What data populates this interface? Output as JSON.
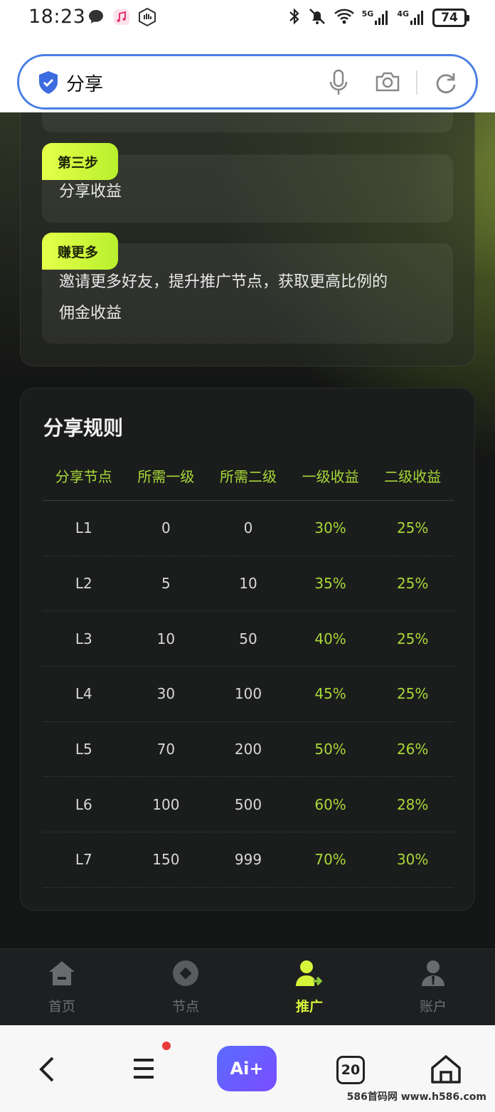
{
  "status_bar": {
    "time": "18:23",
    "network_5g": "5G",
    "network_4g": "4G",
    "battery": "74",
    "icons": [
      "message-icon",
      "music-icon",
      "hand-icon",
      "bluetooth-icon",
      "mute-icon",
      "wifi-icon",
      "signal-icon"
    ]
  },
  "search": {
    "query": "分享",
    "icons": [
      "shield-icon",
      "mic-icon",
      "camera-icon",
      "reload-icon"
    ]
  },
  "steps": [
    {
      "tag": "第三步",
      "text": "分享收益"
    },
    {
      "tag": "赚更多",
      "text_line1": "邀请更多好友，提升推广节点，获取更高比例的",
      "text_line2": "佣金收益"
    }
  ],
  "rules": {
    "title": "分享规则",
    "headers": [
      "分享节点",
      "所需一级",
      "所需二级",
      "一级收益",
      "二级收益"
    ],
    "rows": [
      [
        "L1",
        "0",
        "0",
        "30%",
        "25%"
      ],
      [
        "L2",
        "5",
        "10",
        "35%",
        "25%"
      ],
      [
        "L3",
        "10",
        "50",
        "40%",
        "25%"
      ],
      [
        "L4",
        "30",
        "100",
        "45%",
        "25%"
      ],
      [
        "L5",
        "70",
        "200",
        "50%",
        "26%"
      ],
      [
        "L6",
        "100",
        "500",
        "60%",
        "28%"
      ],
      [
        "L7",
        "150",
        "999",
        "70%",
        "30%"
      ]
    ]
  },
  "tabbar": {
    "items": [
      {
        "label": "首页",
        "icon": "home-icon",
        "active": false
      },
      {
        "label": "节点",
        "icon": "node-icon",
        "active": false
      },
      {
        "label": "推广",
        "icon": "promote-icon",
        "active": true
      },
      {
        "label": "账户",
        "icon": "account-icon",
        "active": false
      }
    ]
  },
  "browser_bar": {
    "ai_label": "Ai+",
    "tabs_count": "20",
    "watermark": "586首码网 www.h586.com"
  },
  "colors": {
    "accent": "#a8d838",
    "tag_gradient_start": "#e5ff4a",
    "search_border": "#4a7fe3"
  }
}
